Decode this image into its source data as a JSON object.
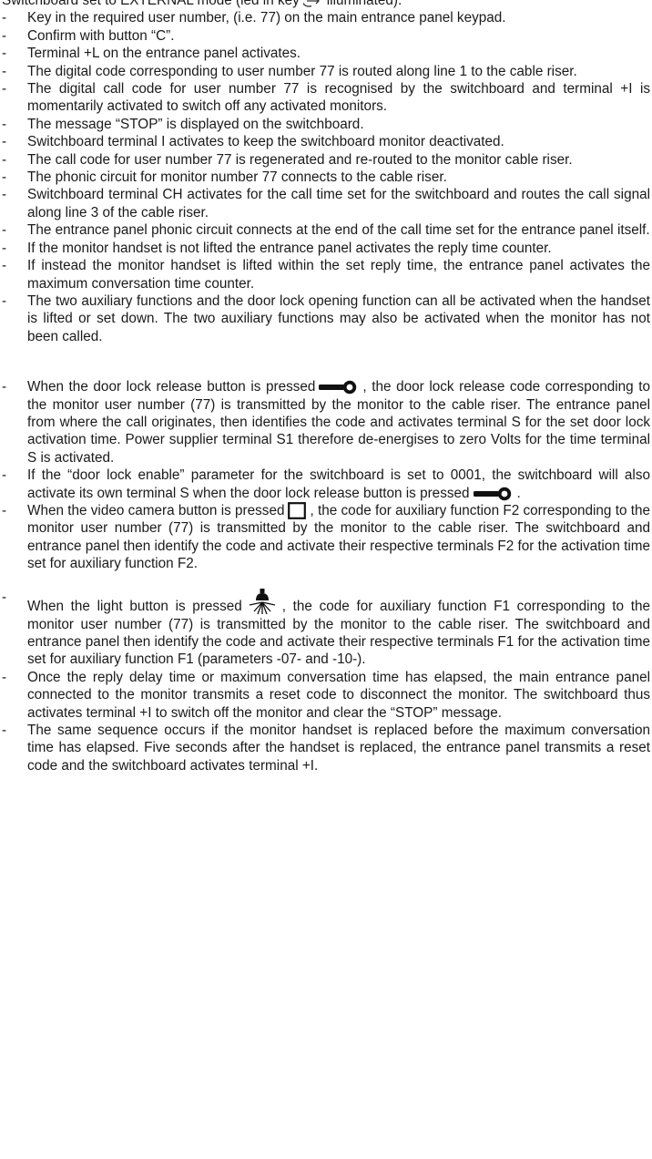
{
  "intro": {
    "before": "Switchboard set to EXTERNAL mode (led in key",
    "after": "illuminated)."
  },
  "dash": "-",
  "items_a": [
    "Key in the required user number, (i.e. 77) on the main entrance panel keypad.",
    "Confirm with button “C”.",
    "Terminal +L on the entrance panel activates.",
    "The digital code corresponding to user number 77 is routed along line 1 to the cable riser.",
    "The digital call code for user number 77 is recognised by the switchboard and terminal +I is momentarily activated to switch off any activated monitors.",
    "The message “STOP” is displayed on the switchboard.",
    "Switchboard terminal I activates to keep the switchboard monitor deactivated.",
    "The call code for user number 77 is regenerated and re-routed to the monitor cable riser.",
    "The phonic circuit for monitor number 77 connects to the cable riser.",
    "Switchboard terminal CH activates for the call time set for the switchboard and routes the call signal along line 3 of the cable riser.",
    "The entrance panel phonic circuit connects at the end of the call time set for the entrance panel itself.",
    "If the monitor handset is not lifted the entrance panel activates the reply time counter.",
    "If instead the monitor handset is lifted within the set reply time, the entrance panel activates the maximum conversation time counter.",
    "The two auxiliary functions and the door lock opening function can all be activated when the handset is lifted or set down. The two auxiliary functions may also be activated when the monitor has not been called."
  ],
  "door_release": {
    "before": "When the door lock release button is pressed",
    "after": ", the door lock release code corresponding to the monitor user number (77) is transmitted by the monitor to the cable riser. The entrance panel from where the call originates, then identifies the code and activates terminal S for the set door lock activation time. Power supplier terminal S1 therefore de-energises to zero Volts for the time terminal S is activated."
  },
  "door_enable": {
    "before": "If the “door lock enable” parameter for the switchboard is set to 0001, the switchboard will also activate its own terminal S when the door lock release button is pressed",
    "after": "."
  },
  "camera": {
    "before": "When the video camera button is pressed",
    "after": ", the code for auxiliary function F2 corresponding to the monitor user number (77) is transmitted by the monitor to the cable riser. The switchboard and entrance panel then identify the code and activate their respective terminals F2 for the activation time set for auxiliary function F2."
  },
  "light": {
    "before": "When the light button is pressed",
    "after": ", the code for auxiliary function F1 corresponding to the monitor user number (77) is transmitted by the monitor to the cable riser. The switchboard and entrance panel then identify the code and activate their respective terminals F1 for the activation time set for auxiliary function F1 (parameters -07- and -10-)."
  },
  "items_final": [
    "Once the reply delay time or maximum conversation time has elapsed, the main entrance panel connected to the monitor transmits a reset code to disconnect the monitor. The switchboard thus activates terminal +I to switch off the monitor and clear the “STOP” message.",
    "The same sequence occurs if the monitor handset is replaced before the maximum conversation time has elapsed. Five seconds after the handset is replaced, the entrance panel transmits a reset code and the switchboard activates terminal +I."
  ],
  "icons": {
    "led": "external-led-icon",
    "key": "key-icon",
    "camera": "video-camera-icon",
    "light": "light-bulb-icon"
  }
}
